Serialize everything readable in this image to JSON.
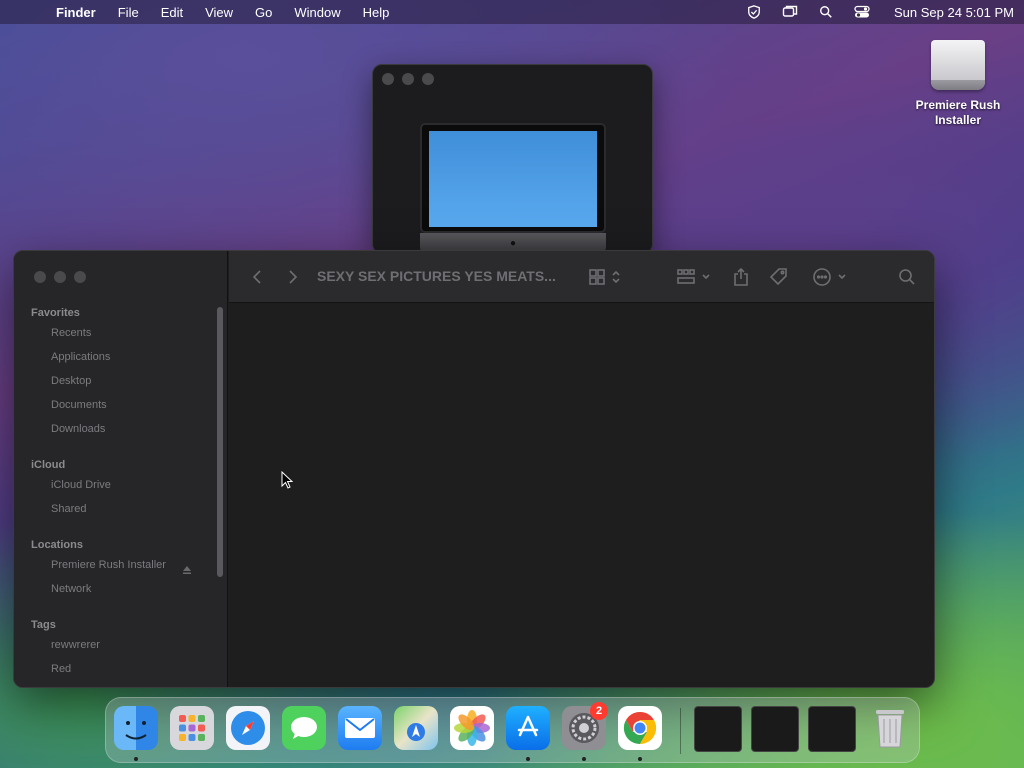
{
  "menubar": {
    "apple": "",
    "app_name": "Finder",
    "menus": [
      "File",
      "Edit",
      "View",
      "Go",
      "Window",
      "Help"
    ],
    "clock": "Sun Sep 24  5:01 PM"
  },
  "desktop": {
    "icon_label_line1": "Premiere Rush",
    "icon_label_line2": "Installer"
  },
  "finder": {
    "title": "SEXY SEX PICTURES YES MEATS...",
    "sidebar": {
      "favorites_title": "Favorites",
      "favorites": [
        "Recents",
        "Applications",
        "Desktop",
        "Documents",
        "Downloads"
      ],
      "icloud_title": "iCloud",
      "icloud": [
        "iCloud Drive",
        "Shared"
      ],
      "locations_title": "Locations",
      "locations": [
        "Premiere Rush Installer",
        "Network"
      ],
      "tags_title": "Tags",
      "tags": [
        "rewwrerer",
        "Red"
      ]
    }
  },
  "dock": {
    "settings_badge": "2",
    "apps": [
      "finder",
      "launchpad",
      "safari",
      "messages",
      "mail",
      "maps",
      "photos",
      "app-store",
      "system-settings",
      "chrome"
    ]
  },
  "colors": {
    "window_bg": "#1e1e1e",
    "sidebar_bg": "#262628",
    "badge": "#ff3b30"
  }
}
